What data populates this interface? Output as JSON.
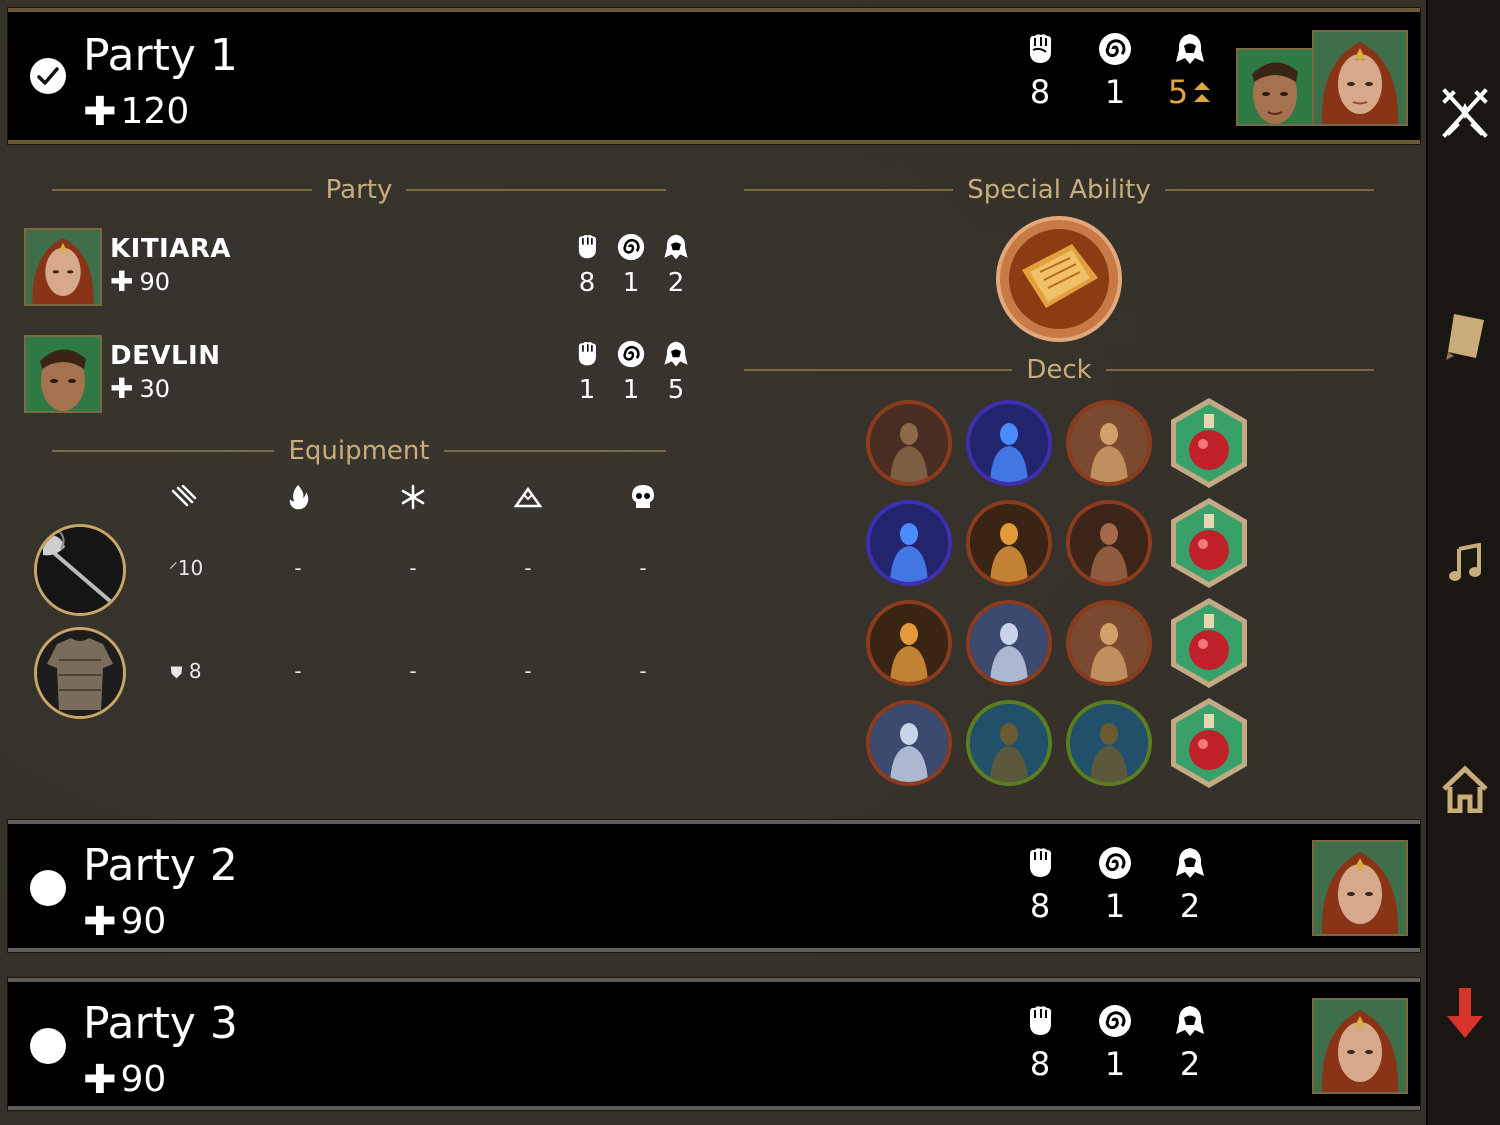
{
  "parties": [
    {
      "name": "Party 1",
      "hp": "120",
      "stats": [
        "8",
        "1",
        "5"
      ],
      "selected": true
    },
    {
      "name": "Party 2",
      "hp": "90",
      "stats": [
        "8",
        "1",
        "2"
      ],
      "selected": false
    },
    {
      "name": "Party 3",
      "hp": "90",
      "stats": [
        "8",
        "1",
        "2"
      ],
      "selected": false
    }
  ],
  "details": {
    "party_heading": "Party",
    "special_heading": "Special Ability",
    "deck_heading": "Deck",
    "equipment_heading": "Equipment",
    "members": [
      {
        "name": "KITIARA",
        "hp": "90",
        "stats": [
          "8",
          "1",
          "2"
        ]
      },
      {
        "name": "DEVLIN",
        "hp": "30",
        "stats": [
          "1",
          "1",
          "5"
        ]
      }
    ],
    "equipment": [
      {
        "item": "axe",
        "values": [
          "10",
          "-",
          "-",
          "-",
          "-"
        ]
      },
      {
        "item": "chainmail",
        "values": [
          "8",
          "-",
          "-",
          "-",
          "-"
        ]
      }
    ],
    "equipment_columns": [
      "claws-icon",
      "fire-icon",
      "frost-icon",
      "mountain-icon",
      "skull-icon"
    ]
  },
  "colors": {
    "gold": "#c8ad7a",
    "orange_up": "#e0a73f",
    "red_arrow": "#d6332b"
  },
  "sidebar": [
    "crossed-swords-icon",
    "book-icon",
    "music-note-icon",
    "home-icon",
    "down-arrow-icon"
  ]
}
